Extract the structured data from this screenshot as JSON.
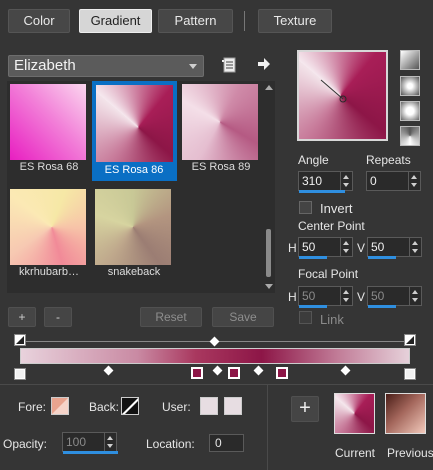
{
  "tabs": [
    {
      "label": "Color",
      "active": false
    },
    {
      "label": "Gradient",
      "active": true
    },
    {
      "label": "Pattern",
      "active": false
    },
    {
      "label": "Texture",
      "active": false
    }
  ],
  "preset": {
    "selected": "Elizabeth"
  },
  "gallery": [
    {
      "label": "ES Rosa 68",
      "selected": false
    },
    {
      "label": "ES Rosa 86",
      "selected": true
    },
    {
      "label": "ES Rosa 89",
      "selected": false
    },
    {
      "label": "kkrhubarb…",
      "selected": false
    },
    {
      "label": "snakeback",
      "selected": false
    }
  ],
  "gallery_buttons": {
    "add": "+",
    "remove": "-",
    "reset": "Reset",
    "save": "Save"
  },
  "angle": {
    "label": "Angle",
    "value": "310"
  },
  "repeats": {
    "label": "Repeats",
    "value": "0"
  },
  "invert": {
    "label": "Invert"
  },
  "center_point": {
    "label": "Center Point",
    "h_label": "H",
    "h_value": "50",
    "v_label": "V",
    "v_value": "50"
  },
  "focal_point": {
    "label": "Focal Point",
    "h_label": "H",
    "h_value": "50",
    "v_label": "V",
    "v_value": "50"
  },
  "link": {
    "label": "Link"
  },
  "bottom": {
    "fore_label": "Fore:",
    "back_label": "Back:",
    "user_label": "User:",
    "opacity_label": "Opacity:",
    "opacity_value": "100",
    "location_label": "Location:",
    "location_value": "0",
    "current_label": "Current",
    "previous_label": "Previous",
    "add_button": "+"
  },
  "colors": {
    "accent": "#0a6fc4",
    "background": "#353535",
    "gradient_dark": "#8d1647",
    "gradient_light": "#e8d2dc"
  }
}
